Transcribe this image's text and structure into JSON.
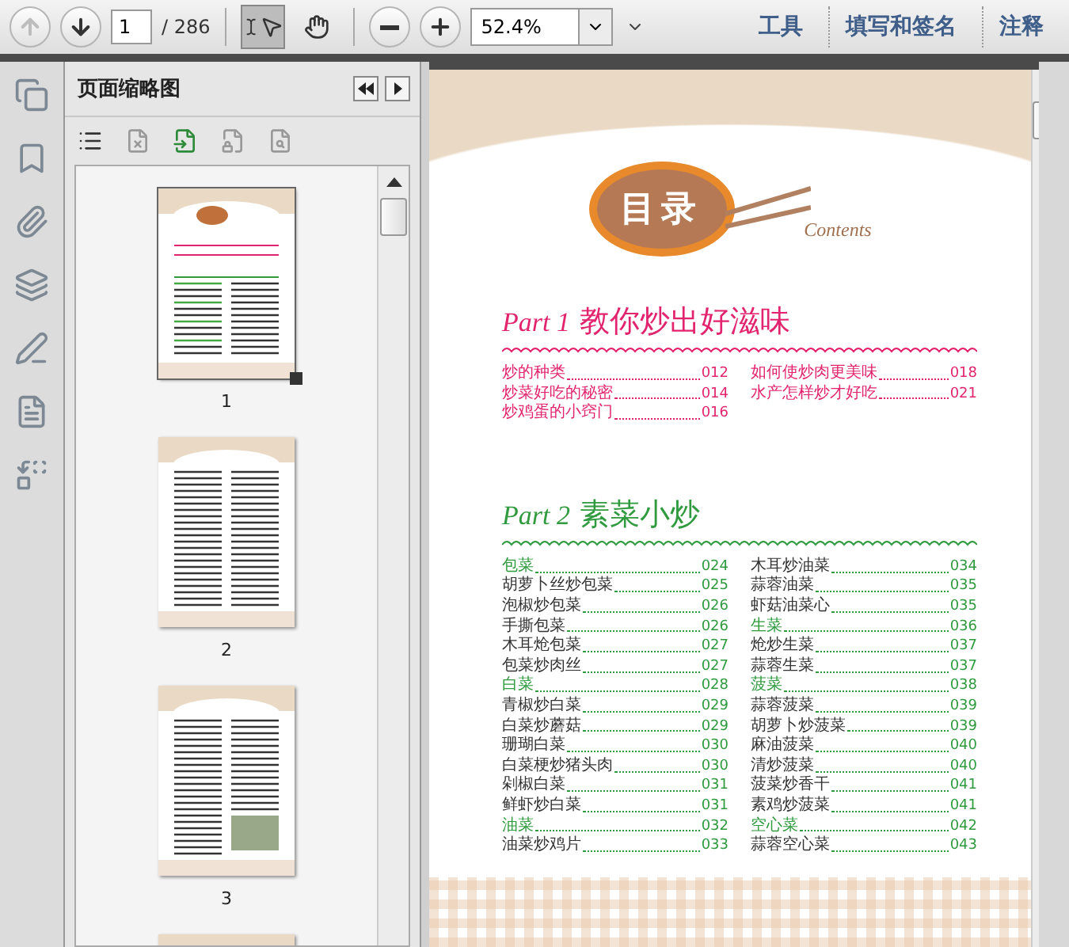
{
  "toolbar": {
    "prev_page": {
      "disabled": true
    },
    "next_page": {
      "disabled": false
    },
    "page_input": {
      "value": "1"
    },
    "page_count": "/ 286",
    "tools": [
      {
        "kind": "select",
        "selected": true
      },
      {
        "kind": "hand",
        "selected": false
      }
    ],
    "zoom": {
      "value": "52.4%"
    },
    "panels": [
      {
        "label": "工具"
      },
      {
        "label": "填写和签名"
      },
      {
        "label": "注释"
      }
    ]
  },
  "sidebar": {
    "title": "页面缩略图",
    "thumbnails": [
      {
        "label": "1",
        "kind": "contents",
        "selected": true
      },
      {
        "label": "2",
        "kind": "list",
        "selected": false
      },
      {
        "label": "3",
        "kind": "photo",
        "selected": false
      },
      {
        "kind": "partial",
        "selected": false
      }
    ]
  },
  "document": {
    "title": "目录",
    "subtitle": "Contents",
    "parts": [
      {
        "label": "Part 1",
        "title": "教你炒出好滋味",
        "color": "#e2246e",
        "columns": [
          [
            {
              "kind": "dish",
              "name": "炒的种类",
              "page": "012"
            },
            {
              "kind": "dish",
              "name": "炒菜好吃的秘密",
              "page": "014"
            },
            {
              "kind": "dish",
              "name": "炒鸡蛋的小窍门",
              "page": "016"
            }
          ],
          [
            {
              "kind": "dish",
              "name": "如何使炒肉更美味",
              "page": "018"
            },
            {
              "kind": "dish",
              "name": "水产怎样炒才好吃",
              "page": "021"
            }
          ]
        ]
      },
      {
        "label": "Part 2",
        "title": "素菜小炒",
        "color": "#2f9a3e",
        "columns": [
          [
            {
              "kind": "category",
              "name": "包菜",
              "page": "024"
            },
            {
              "kind": "dish",
              "name": "胡萝卜丝炒包菜",
              "page": "025"
            },
            {
              "kind": "dish",
              "name": "泡椒炒包菜",
              "page": "026"
            },
            {
              "kind": "dish",
              "name": "手撕包菜",
              "page": "026"
            },
            {
              "kind": "dish",
              "name": "木耳炝包菜",
              "page": "027"
            },
            {
              "kind": "dish",
              "name": "包菜炒肉丝",
              "page": "027"
            },
            {
              "kind": "category",
              "name": "白菜",
              "page": "028"
            },
            {
              "kind": "dish",
              "name": "青椒炒白菜",
              "page": "029"
            },
            {
              "kind": "dish",
              "name": "白菜炒蘑菇",
              "page": "029"
            },
            {
              "kind": "dish",
              "name": "珊瑚白菜",
              "page": "030"
            },
            {
              "kind": "dish",
              "name": "白菜梗炒猪头肉",
              "page": "030"
            },
            {
              "kind": "dish",
              "name": "剁椒白菜",
              "page": "031"
            },
            {
              "kind": "dish",
              "name": "鲜虾炒白菜",
              "page": "031"
            },
            {
              "kind": "category",
              "name": "油菜",
              "page": "032"
            },
            {
              "kind": "dish",
              "name": "油菜炒鸡片",
              "page": "033"
            }
          ],
          [
            {
              "kind": "dish",
              "name": "木耳炒油菜",
              "page": "034"
            },
            {
              "kind": "dish",
              "name": "蒜蓉油菜",
              "page": "035"
            },
            {
              "kind": "dish",
              "name": "虾菇油菜心",
              "page": "035"
            },
            {
              "kind": "category",
              "name": "生菜",
              "page": "036"
            },
            {
              "kind": "dish",
              "name": "炝炒生菜",
              "page": "037"
            },
            {
              "kind": "dish",
              "name": "蒜蓉生菜",
              "page": "037"
            },
            {
              "kind": "category",
              "name": "菠菜",
              "page": "038"
            },
            {
              "kind": "dish",
              "name": "蒜蓉菠菜",
              "page": "039"
            },
            {
              "kind": "dish",
              "name": "胡萝卜炒菠菜",
              "page": "039"
            },
            {
              "kind": "dish",
              "name": "麻油菠菜",
              "page": "040"
            },
            {
              "kind": "dish",
              "name": "清炒菠菜",
              "page": "040"
            },
            {
              "kind": "dish",
              "name": "菠菜炒香干",
              "page": "041"
            },
            {
              "kind": "dish",
              "name": "素鸡炒菠菜",
              "page": "041"
            },
            {
              "kind": "category",
              "name": "空心菜",
              "page": "042"
            },
            {
              "kind": "dish",
              "name": "蒜蓉空心菜",
              "page": "043"
            }
          ]
        ]
      }
    ]
  }
}
